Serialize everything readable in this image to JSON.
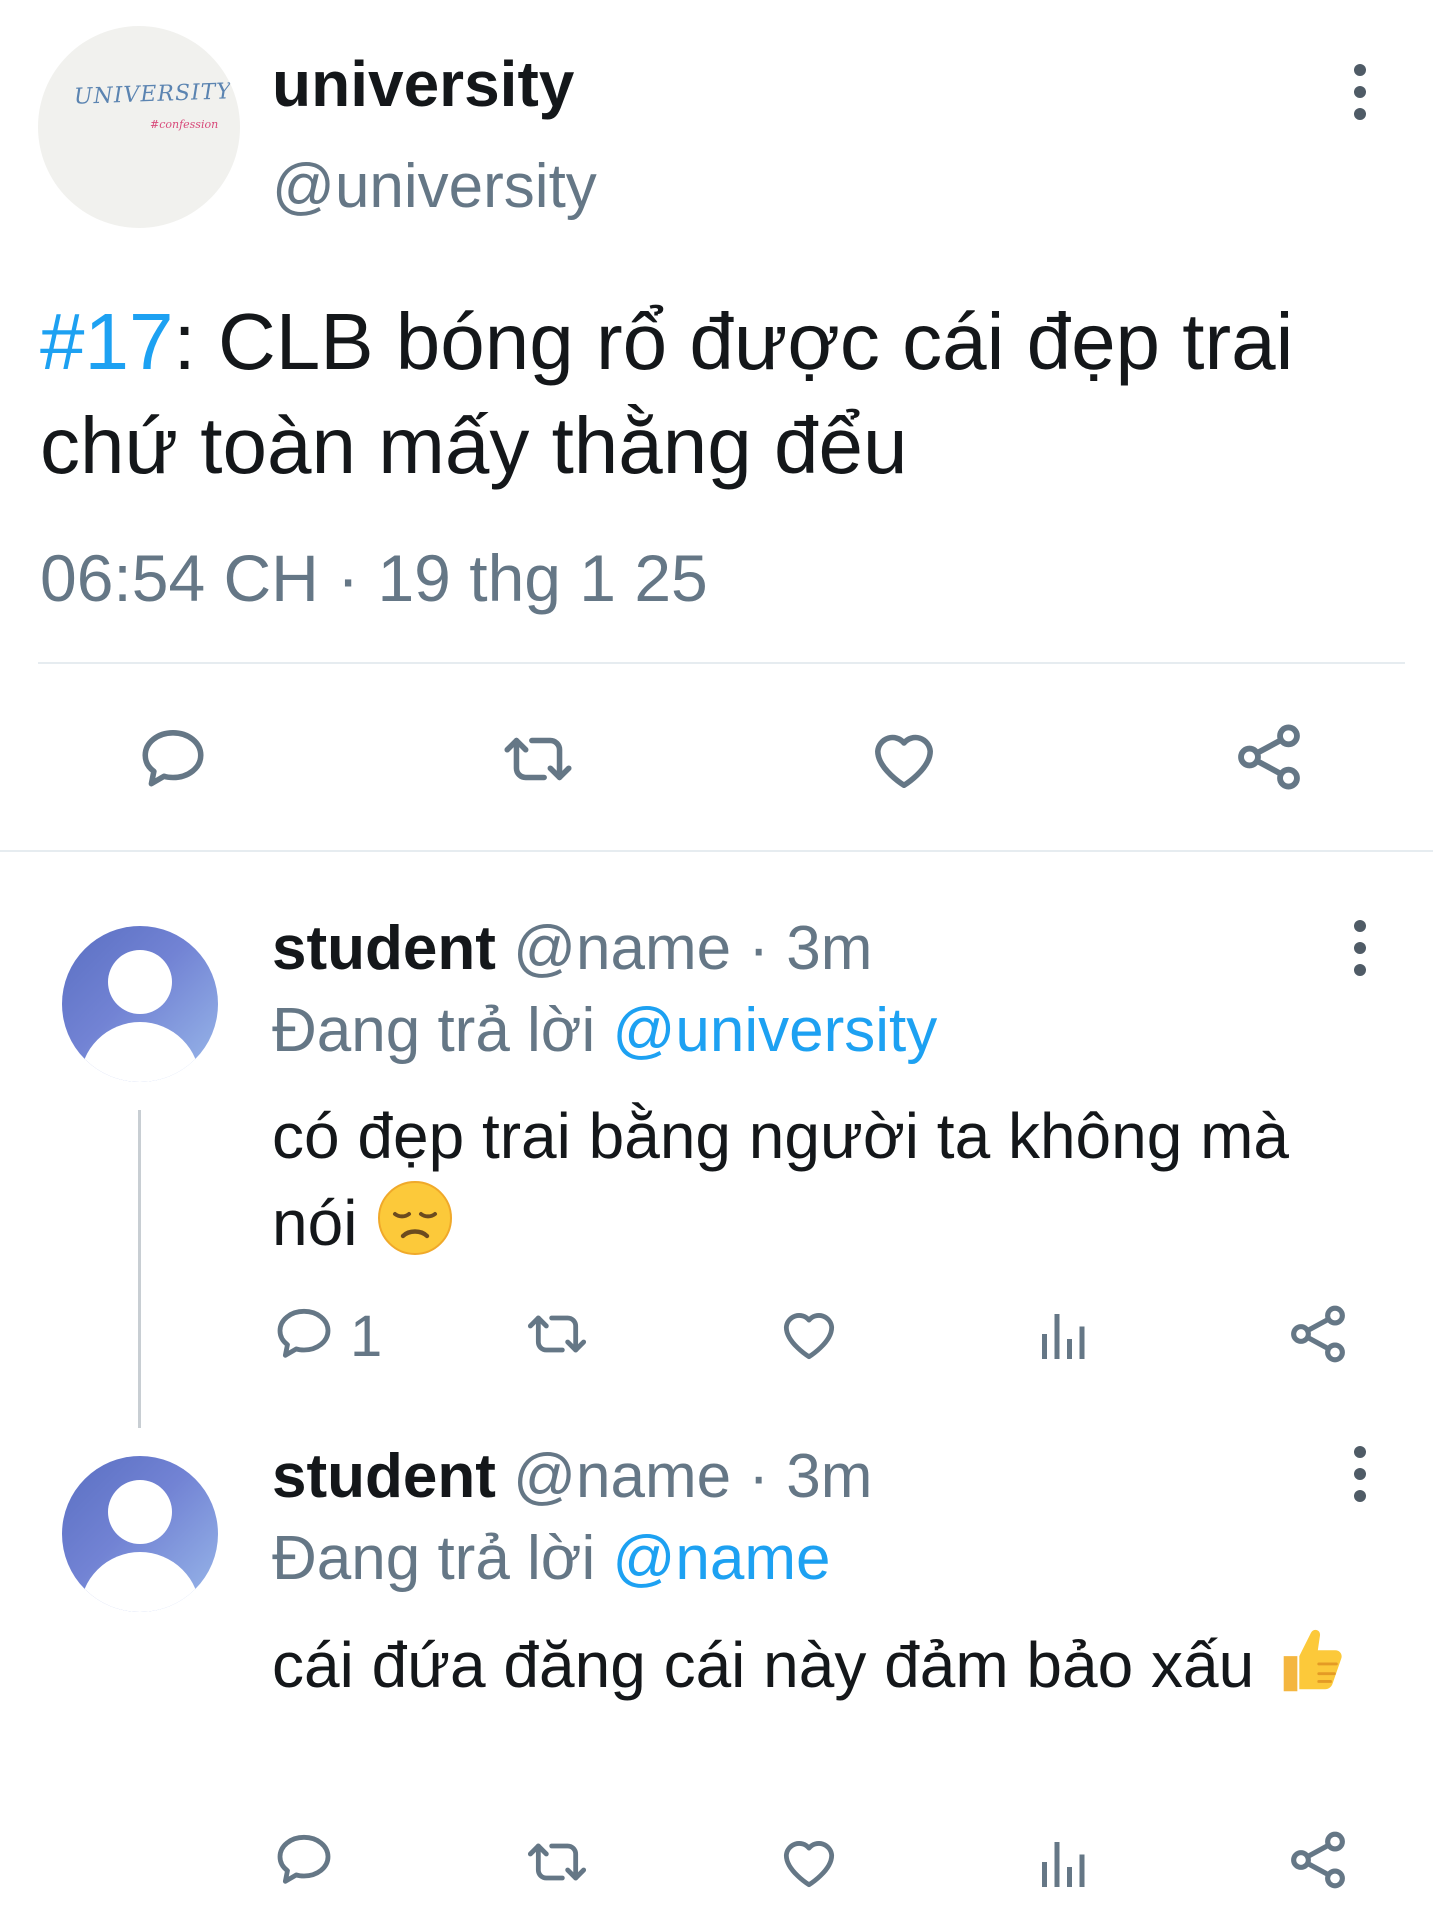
{
  "tweet": {
    "display_name": "university",
    "handle": "@university",
    "avatar_text": "UNIVERSITY",
    "avatar_subtext": "#confession",
    "hashtag": "#17",
    "text": ": CLB bóng rổ được cái đẹp trai chứ toàn mấy thằng đểu",
    "timestamp": "06:54 CH · 19 thg 1 25",
    "icons": {
      "reply": "reply-icon",
      "retweet": "retweet-icon",
      "like": "heart-icon",
      "share": "share-icon",
      "more": "more-vertical-icon"
    }
  },
  "replies": [
    {
      "display_name": "student",
      "handle": "@name",
      "separator": "·",
      "time": "3m",
      "replying_prefix": "Đang trả lời",
      "replying_to": "@university",
      "text": "có đẹp trai bằng người ta không mà nói",
      "emoji": "disappointed-face",
      "reply_count": "1"
    },
    {
      "display_name": "student",
      "handle": "@name",
      "separator": "·",
      "time": "3m",
      "replying_prefix": "Đang trả lời",
      "replying_to": "@name",
      "text": "cái đứa đăng cái này đảm bảo xấu",
      "emoji": "thumbs-up",
      "reply_count": ""
    }
  ],
  "colors": {
    "accent": "#1da1f2",
    "text": "#14171a",
    "muted": "#657786",
    "divider": "#e6ecf0"
  }
}
